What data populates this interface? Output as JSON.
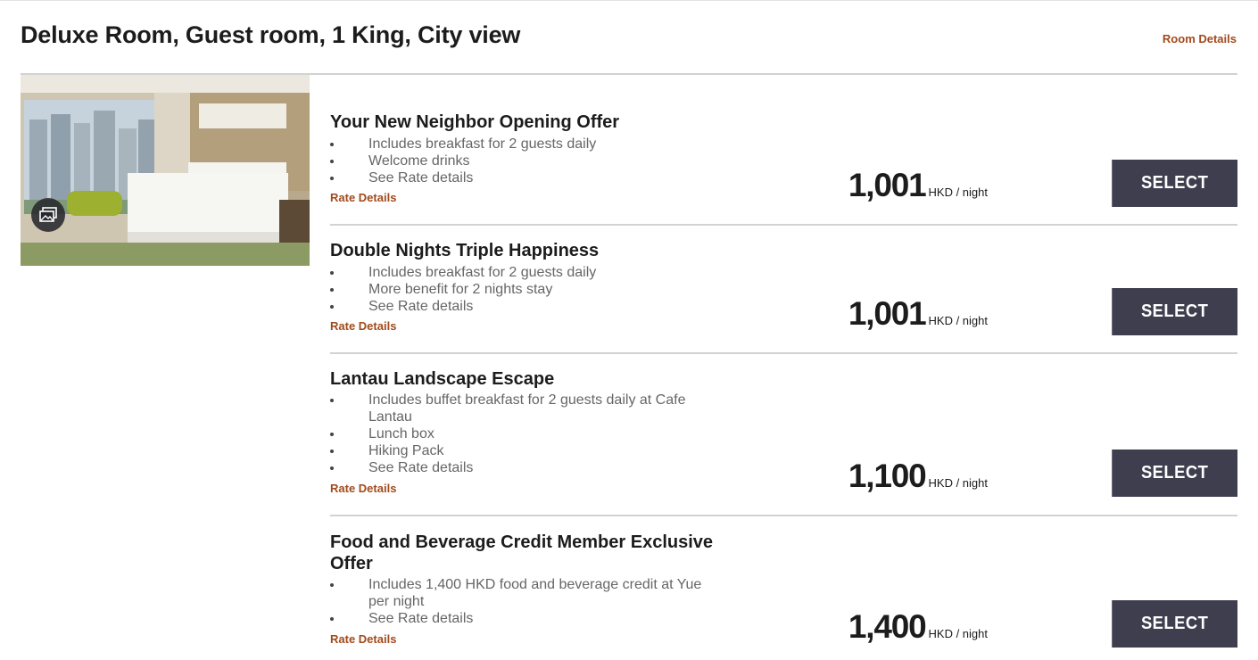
{
  "room": {
    "title": "Deluxe Room, Guest room, 1 King, City view",
    "details_link": "Room Details"
  },
  "colors": {
    "accent": "#a24a1c",
    "button_bg": "#3f3e4f",
    "button_text": "#ffffff",
    "divider": "#d2d2d2"
  },
  "icons": {
    "gallery": "image-gallery-icon"
  },
  "rates": [
    {
      "name": "Your New Neighbor Opening Offer",
      "benefits": [
        "Includes breakfast for 2 guests daily",
        "Welcome drinks",
        "See Rate details"
      ],
      "details_link": "Rate Details",
      "price": "1,001",
      "unit": "HKD / night",
      "select_label": "SELECT"
    },
    {
      "name": "Double Nights Triple Happiness",
      "benefits": [
        "Includes breakfast for 2 guests daily",
        "More benefit for 2 nights stay",
        "See Rate details"
      ],
      "details_link": "Rate Details",
      "price": "1,001",
      "unit": "HKD / night",
      "select_label": "SELECT"
    },
    {
      "name": "Lantau Landscape Escape",
      "benefits": [
        "Includes buffet breakfast for 2 guests daily at Cafe Lantau",
        "Lunch box",
        "Hiking Pack",
        "See Rate details"
      ],
      "details_link": "Rate Details",
      "price": "1,100",
      "unit": "HKD / night",
      "select_label": "SELECT"
    },
    {
      "name": "Food and Beverage Credit Member Exclusive Offer",
      "benefits": [
        "Includes 1,400 HKD food and beverage credit at Yue per night",
        "See Rate details"
      ],
      "details_link": "Rate Details",
      "price": "1,400",
      "unit": "HKD / night",
      "select_label": "SELECT"
    }
  ]
}
